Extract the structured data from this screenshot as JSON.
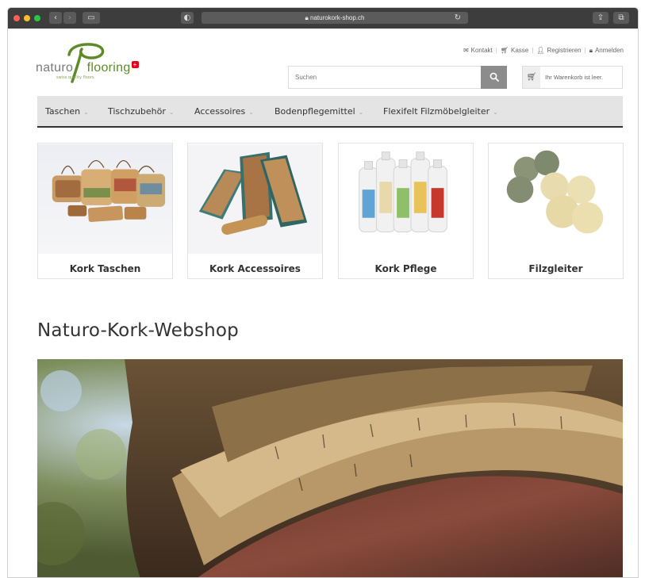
{
  "browser": {
    "url": "naturokork-shop.ch"
  },
  "logo": {
    "brand_left": "naturo",
    "brand_right": "flooring",
    "tagline": "swiss quality floors"
  },
  "toplinks": {
    "contact": "Kontakt",
    "checkout": "Kasse",
    "register": "Registrieren",
    "login": "Anmelden"
  },
  "search": {
    "placeholder": "Suchen"
  },
  "cart": {
    "status": "Ihr Warenkorb ist leer."
  },
  "nav": [
    {
      "label": "Taschen"
    },
    {
      "label": "Tischzubehör"
    },
    {
      "label": "Accessoires"
    },
    {
      "label": "Bodenpflegemittel"
    },
    {
      "label": "Flexifelt Filzmöbelgleiter"
    }
  ],
  "categories": [
    {
      "label": "Kork Taschen"
    },
    {
      "label": "Kork Accessoires"
    },
    {
      "label": "Kork Pflege"
    },
    {
      "label": "Filzgleiter"
    }
  ],
  "main": {
    "title": "Naturo-Kork-Webshop"
  },
  "colors": {
    "brand_green": "#5e8b2a",
    "swiss_red": "#e2001a",
    "nav_bg": "#e4e4e4"
  }
}
